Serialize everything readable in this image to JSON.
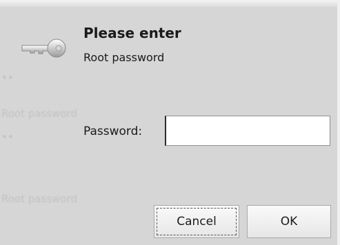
{
  "dialog": {
    "title": "Please enter",
    "subtitle": "Root password",
    "password_label": "Password:",
    "password_value": "",
    "cancel_label": "Cancel",
    "ok_label": "OK"
  },
  "background_ghost": {
    "line1": "Root password",
    "line2": "Root password"
  },
  "icons": {
    "dialog_icon": "key-icon"
  },
  "colors": {
    "dialog_background": "#d6d6d6",
    "input_background": "#ffffff",
    "text": "#1a1a1a"
  }
}
